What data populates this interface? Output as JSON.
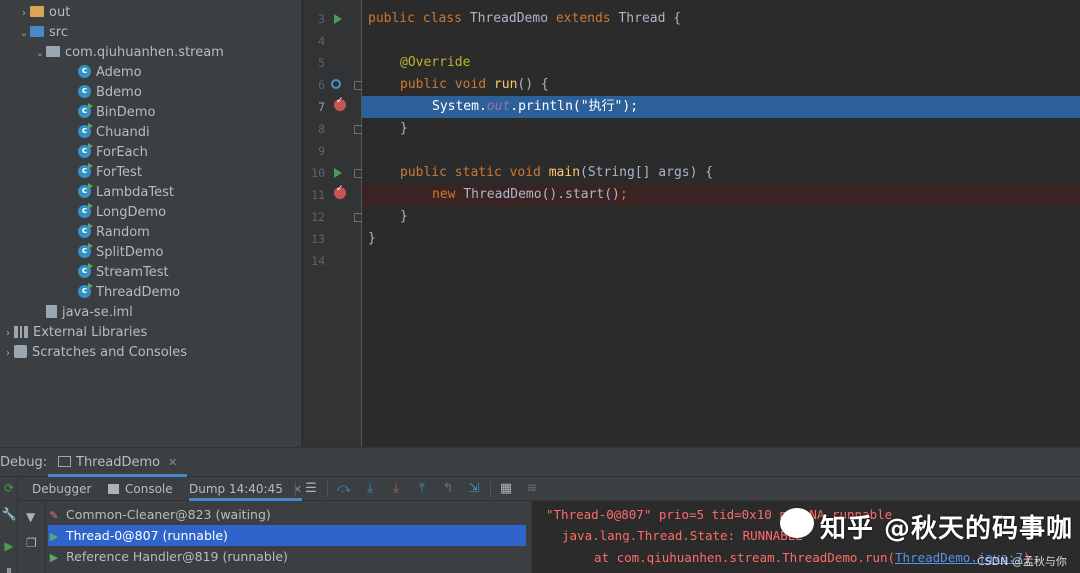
{
  "project_tree": [
    {
      "label": "out",
      "type": "folder",
      "indent": 1,
      "arrow": "›"
    },
    {
      "label": "src",
      "type": "folder-blue",
      "indent": 1,
      "arrow": "⌄"
    },
    {
      "label": "com.qiuhuanhen.stream",
      "type": "package",
      "indent": 2,
      "arrow": "⌄"
    },
    {
      "label": "Ademo",
      "type": "class",
      "indent": 4
    },
    {
      "label": "Bdemo",
      "type": "class",
      "indent": 4
    },
    {
      "label": "BinDemo",
      "type": "class-run",
      "indent": 4
    },
    {
      "label": "Chuandi",
      "type": "class-run",
      "indent": 4
    },
    {
      "label": "ForEach",
      "type": "class-run",
      "indent": 4
    },
    {
      "label": "ForTest",
      "type": "class-run",
      "indent": 4
    },
    {
      "label": "LambdaTest",
      "type": "class-run",
      "indent": 4
    },
    {
      "label": "LongDemo",
      "type": "class-run",
      "indent": 4
    },
    {
      "label": "Random",
      "type": "class-run",
      "indent": 4
    },
    {
      "label": "SplitDemo",
      "type": "class-run",
      "indent": 4
    },
    {
      "label": "StreamTest",
      "type": "class-run",
      "indent": 4
    },
    {
      "label": "ThreadDemo",
      "type": "class-run",
      "indent": 4
    },
    {
      "label": "java-se.iml",
      "type": "file",
      "indent": 2
    },
    {
      "label": "External Libraries",
      "type": "lib",
      "indent": 0,
      "arrow": "›"
    },
    {
      "label": "Scratches and Consoles",
      "type": "scratch",
      "indent": 0,
      "arrow": "›"
    }
  ],
  "editor": {
    "lines": [
      {
        "num": "3"
      },
      {
        "num": "4"
      },
      {
        "num": "5"
      },
      {
        "num": "6"
      },
      {
        "num": "7"
      },
      {
        "num": "8"
      },
      {
        "num": "9"
      },
      {
        "num": "10"
      },
      {
        "num": "11"
      },
      {
        "num": "12"
      },
      {
        "num": "13"
      },
      {
        "num": "14"
      }
    ],
    "code": {
      "l3_kw": "public class ",
      "l3_name": "ThreadDemo ",
      "l3_kw2": "extends ",
      "l3_rest": "Thread {",
      "l5_ann": "@Override",
      "l6_kw": "public void ",
      "l6_fn": "run",
      "l6_rest": "() {",
      "l7_a": "System.",
      "l7_fld": "out",
      "l7_b": ".println(",
      "l7_str": "\"执行\"",
      "l7_c": ");",
      "l8": "}",
      "l10_kw": "public static void ",
      "l10_fn": "main",
      "l10_rest": "(String[] args) {",
      "l11_kw": "new ",
      "l11_rest": "ThreadDemo().start()",
      "l11_semi": ";",
      "l12": "}",
      "l13": "}"
    }
  },
  "debug": {
    "label": "Debug:",
    "tab": "ThreadDemo",
    "tabs": [
      "Debugger",
      "Console",
      "Dump 14:40:45"
    ],
    "threads": [
      {
        "label": "Common-Cleaner@823 (waiting)",
        "icon": "wait"
      },
      {
        "label": "Thread-0@807 (runnable)",
        "icon": "run"
      },
      {
        "label": "Reference Handler@819 (runnable)",
        "icon": "run"
      }
    ],
    "dump": {
      "line1": "\"Thread-0@807\" prio=5 tid=0x10 nid=NA runnable",
      "line2": "java.lang.Thread.State: RUNNABLE",
      "line3_a": "at com.qiuhuanhen.stream.ThreadDemo.run(",
      "line3_link": "ThreadDemo.java:7",
      "line3_b": ")"
    }
  },
  "watermark": {
    "main": "知乎 @秋天的码事咖",
    "sub": "CSDN @孟秋与你"
  }
}
